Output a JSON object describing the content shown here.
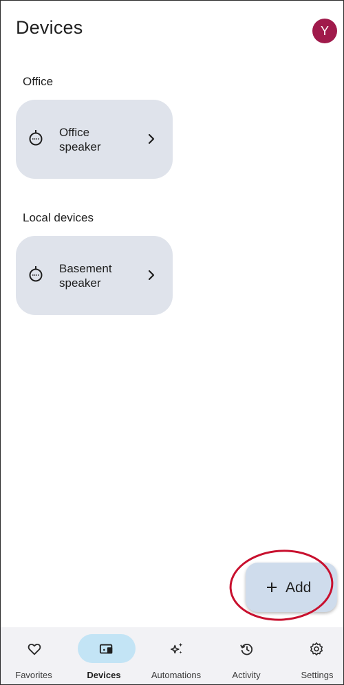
{
  "header": {
    "title": "Devices",
    "avatar_initial": "Y",
    "avatar_color": "#a01a4b"
  },
  "sections": [
    {
      "title": "Office",
      "devices": [
        {
          "name_line1": "Office",
          "name_line2": "speaker",
          "icon": "speaker-icon"
        }
      ]
    },
    {
      "title": "Local devices",
      "devices": [
        {
          "name_line1": "Basement",
          "name_line2": "speaker",
          "icon": "speaker-icon"
        }
      ]
    }
  ],
  "fab": {
    "label": "Add",
    "icon": "plus-icon",
    "highlight_color": "#c8102e"
  },
  "bottom_nav": {
    "active": "Devices",
    "active_color": "#c3e4f5",
    "items": [
      {
        "label": "Favorites",
        "icon": "heart-icon"
      },
      {
        "label": "Devices",
        "icon": "devices-icon"
      },
      {
        "label": "Automations",
        "icon": "sparkle-icon"
      },
      {
        "label": "Activity",
        "icon": "history-icon"
      },
      {
        "label": "Settings",
        "icon": "gear-icon"
      }
    ]
  }
}
